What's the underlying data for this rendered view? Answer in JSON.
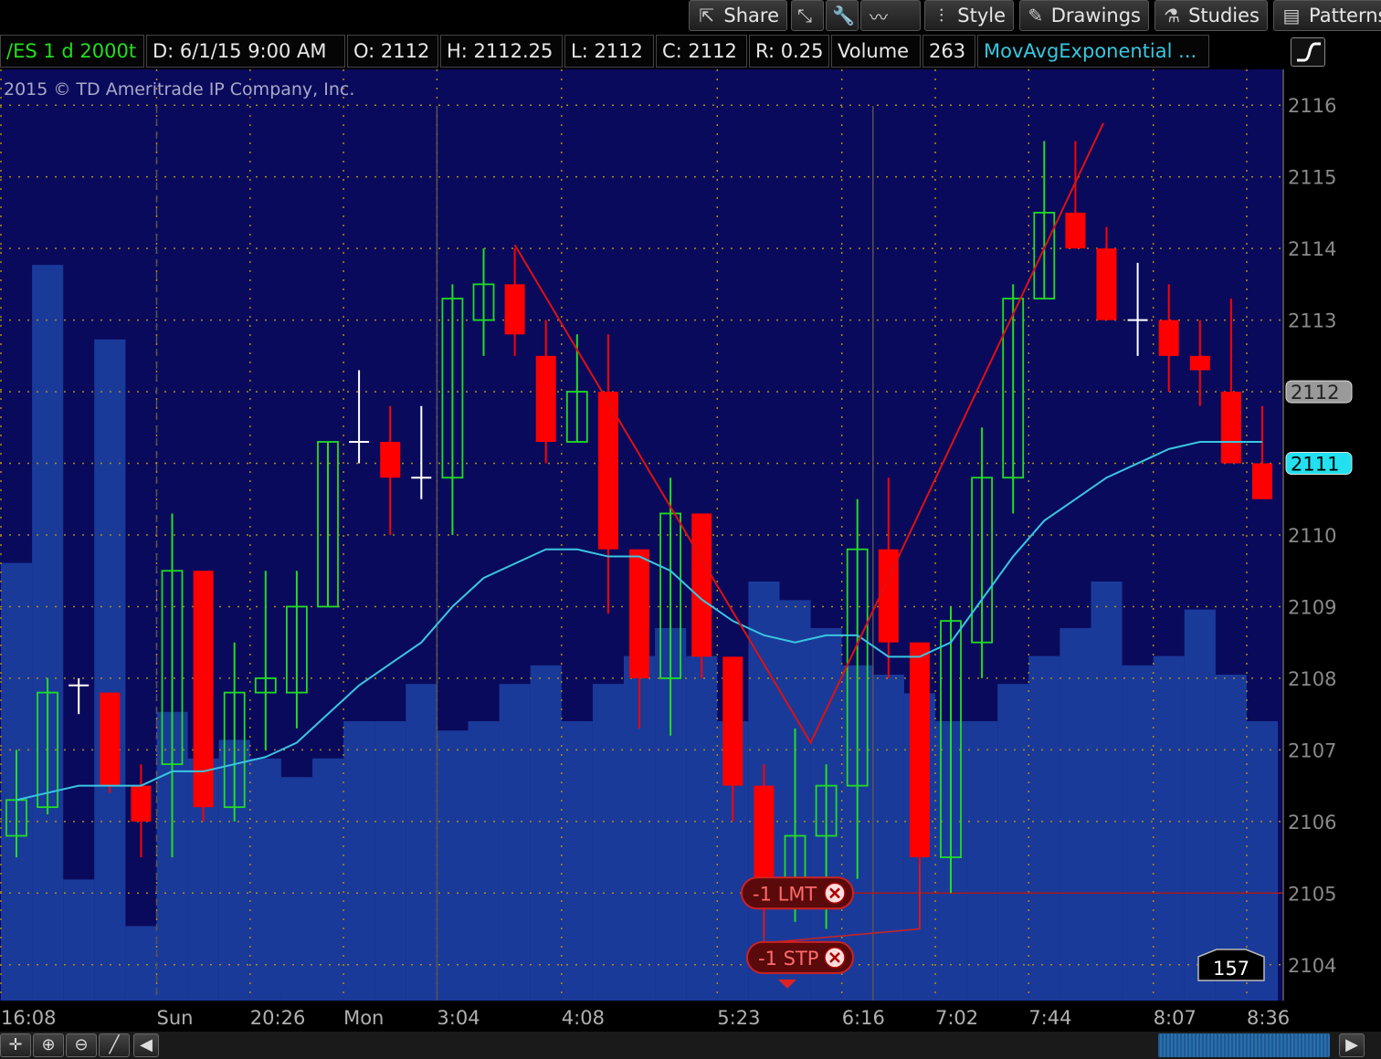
{
  "toolbar": {
    "buttons": [
      {
        "label": "Share",
        "icon": "share-icon"
      },
      {
        "label": "",
        "icon": "arrows-icon"
      },
      {
        "label": "",
        "icon": "wrench-icon"
      },
      {
        "label": "",
        "icon": "pulse-icon"
      },
      {
        "label": "Style",
        "icon": "style-icon"
      },
      {
        "label": "Drawings",
        "icon": "pencil-icon"
      },
      {
        "label": "Studies",
        "icon": "studies-icon"
      },
      {
        "label": "Patterns",
        "icon": "patterns-icon"
      }
    ]
  },
  "infobar": {
    "symbol": "/ES 1 d 2000t",
    "date": "D: 6/1/15 9:00 AM",
    "open": "O: 2112",
    "high": "H: 2112.25",
    "low": "L: 2112",
    "close": "C: 2112",
    "range": "R: 0.25",
    "volume_label": "Volume",
    "volume_value": "263",
    "study": "MovAvgExponential ..."
  },
  "copyright": "2015 © TD Ameritrade IP Company, Inc.",
  "orders": [
    {
      "label": "-1 LMT",
      "price": 2105
    },
    {
      "label": "-1 STP",
      "price": 2104.1
    }
  ],
  "price_markers": [
    {
      "label": "2112",
      "value": 2112,
      "style": "grey"
    },
    {
      "label": "2111",
      "value": 2111,
      "style": "cyan"
    }
  ],
  "volume_badge": "157",
  "colors": {
    "background": "#0a0a5c",
    "up": "#22dd22",
    "down": "#ff0000",
    "ema": "#39c6e0",
    "volume": "#1a3a9a",
    "trend": "#dd1111"
  },
  "chart_data": {
    "type": "candlestick",
    "ylim": [
      2103.5,
      2116.5
    ],
    "yticks": [
      2104,
      2105,
      2106,
      2107,
      2108,
      2109,
      2110,
      2111,
      2112,
      2113,
      2114,
      2115,
      2116
    ],
    "xticks": [
      {
        "label": "16:08",
        "i": 0
      },
      {
        "label": "Sun",
        "i": 5
      },
      {
        "label": "20:26",
        "i": 8
      },
      {
        "label": "Mon",
        "i": 11
      },
      {
        "label": "3:04",
        "i": 14
      },
      {
        "label": "4:08",
        "i": 18
      },
      {
        "label": "5:23",
        "i": 23
      },
      {
        "label": "6:16",
        "i": 27
      },
      {
        "label": "7:02",
        "i": 30
      },
      {
        "label": "7:44",
        "i": 33
      },
      {
        "label": "8:07",
        "i": 37
      },
      {
        "label": "8:36",
        "i": 40
      }
    ],
    "candles": [
      {
        "o": 2105.8,
        "h": 2107.0,
        "l": 2105.5,
        "c": 2106.3
      },
      {
        "o": 2106.2,
        "h": 2108.0,
        "l": 2106.1,
        "c": 2107.8
      },
      {
        "o": 2107.9,
        "h": 2108.0,
        "l": 2107.5,
        "c": 2107.9
      },
      {
        "o": 2107.8,
        "h": 2107.8,
        "l": 2106.4,
        "c": 2106.5
      },
      {
        "o": 2106.5,
        "h": 2106.8,
        "l": 2105.5,
        "c": 2106.0
      },
      {
        "o": 2106.8,
        "h": 2110.3,
        "l": 2105.5,
        "c": 2109.5
      },
      {
        "o": 2109.5,
        "h": 2109.5,
        "l": 2106.0,
        "c": 2106.2
      },
      {
        "o": 2106.2,
        "h": 2108.5,
        "l": 2106.0,
        "c": 2107.8
      },
      {
        "o": 2107.8,
        "h": 2109.5,
        "l": 2107.0,
        "c": 2108.0
      },
      {
        "o": 2107.8,
        "h": 2109.5,
        "l": 2107.3,
        "c": 2109.0
      },
      {
        "o": 2109.0,
        "h": 2111.3,
        "l": 2109.0,
        "c": 2111.3
      },
      {
        "o": 2111.3,
        "h": 2112.3,
        "l": 2111.0,
        "c": 2111.3
      },
      {
        "o": 2111.3,
        "h": 2111.8,
        "l": 2110.0,
        "c": 2110.8
      },
      {
        "o": 2110.8,
        "h": 2111.8,
        "l": 2110.5,
        "c": 2110.8
      },
      {
        "o": 2110.8,
        "h": 2113.5,
        "l": 2110.0,
        "c": 2113.3
      },
      {
        "o": 2113.0,
        "h": 2114.0,
        "l": 2112.5,
        "c": 2113.5
      },
      {
        "o": 2113.5,
        "h": 2114.0,
        "l": 2112.5,
        "c": 2112.8
      },
      {
        "o": 2112.5,
        "h": 2113.0,
        "l": 2111.0,
        "c": 2111.3
      },
      {
        "o": 2111.3,
        "h": 2112.8,
        "l": 2111.3,
        "c": 2112.0
      },
      {
        "o": 2112.0,
        "h": 2112.8,
        "l": 2108.9,
        "c": 2109.8
      },
      {
        "o": 2109.8,
        "h": 2109.8,
        "l": 2107.3,
        "c": 2108.0
      },
      {
        "o": 2108.0,
        "h": 2110.8,
        "l": 2107.2,
        "c": 2110.3
      },
      {
        "o": 2110.3,
        "h": 2110.3,
        "l": 2108.0,
        "c": 2108.3
      },
      {
        "o": 2108.3,
        "h": 2108.3,
        "l": 2106.0,
        "c": 2106.5
      },
      {
        "o": 2106.5,
        "h": 2106.8,
        "l": 2104.4,
        "c": 2104.8
      },
      {
        "o": 2105.0,
        "h": 2107.3,
        "l": 2104.6,
        "c": 2105.8
      },
      {
        "o": 2105.8,
        "h": 2106.8,
        "l": 2104.5,
        "c": 2106.5
      },
      {
        "o": 2106.5,
        "h": 2110.5,
        "l": 2105.2,
        "c": 2109.8
      },
      {
        "o": 2109.8,
        "h": 2110.8,
        "l": 2108.0,
        "c": 2108.5
      },
      {
        "o": 2108.5,
        "h": 2108.5,
        "l": 2104.5,
        "c": 2105.5
      },
      {
        "o": 2105.5,
        "h": 2109.0,
        "l": 2105.0,
        "c": 2108.8
      },
      {
        "o": 2108.5,
        "h": 2111.5,
        "l": 2108.0,
        "c": 2110.8
      },
      {
        "o": 2110.8,
        "h": 2113.5,
        "l": 2110.3,
        "c": 2113.3
      },
      {
        "o": 2113.3,
        "h": 2115.5,
        "l": 2113.3,
        "c": 2114.5
      },
      {
        "o": 2114.5,
        "h": 2115.5,
        "l": 2114.0,
        "c": 2114.0
      },
      {
        "o": 2114.0,
        "h": 2114.3,
        "l": 2113.0,
        "c": 2113.0
      },
      {
        "o": 2113.0,
        "h": 2113.8,
        "l": 2112.5,
        "c": 2113.0
      },
      {
        "o": 2113.0,
        "h": 2113.5,
        "l": 2112.0,
        "c": 2112.5
      },
      {
        "o": 2112.5,
        "h": 2113.0,
        "l": 2111.8,
        "c": 2112.3
      },
      {
        "o": 2112.0,
        "h": 2113.3,
        "l": 2111.3,
        "c": 2111.0
      },
      {
        "o": 2111.0,
        "h": 2111.8,
        "l": 2110.5,
        "c": 2110.5
      }
    ],
    "ema": [
      2106.3,
      2106.4,
      2106.5,
      2106.5,
      2106.5,
      2106.7,
      2106.7,
      2106.8,
      2106.9,
      2107.1,
      2107.5,
      2107.9,
      2108.2,
      2108.5,
      2109.0,
      2109.4,
      2109.6,
      2109.8,
      2109.8,
      2109.7,
      2109.7,
      2109.5,
      2109.1,
      2108.8,
      2108.6,
      2108.5,
      2108.6,
      2108.6,
      2108.3,
      2108.3,
      2108.5,
      2109.1,
      2109.7,
      2110.2,
      2110.5,
      2110.8,
      2111.0,
      2111.2,
      2111.3,
      2111.3,
      2111.3
    ],
    "volume": [
      0.47,
      0.79,
      0.13,
      0.71,
      0.08,
      0.31,
      0.26,
      0.28,
      0.26,
      0.24,
      0.26,
      0.3,
      0.3,
      0.34,
      0.29,
      0.3,
      0.34,
      0.36,
      0.3,
      0.34,
      0.37,
      0.4,
      0.37,
      0.3,
      0.45,
      0.43,
      0.4,
      0.36,
      0.35,
      0.33,
      0.3,
      0.3,
      0.34,
      0.37,
      0.4,
      0.45,
      0.36,
      0.37,
      0.42,
      0.35,
      0.3
    ],
    "trendline": [
      {
        "i": 16,
        "p": 2114.05
      },
      {
        "i": 25.5,
        "p": 2107.1
      },
      {
        "i": 34.9,
        "p": 2115.75
      }
    ]
  }
}
